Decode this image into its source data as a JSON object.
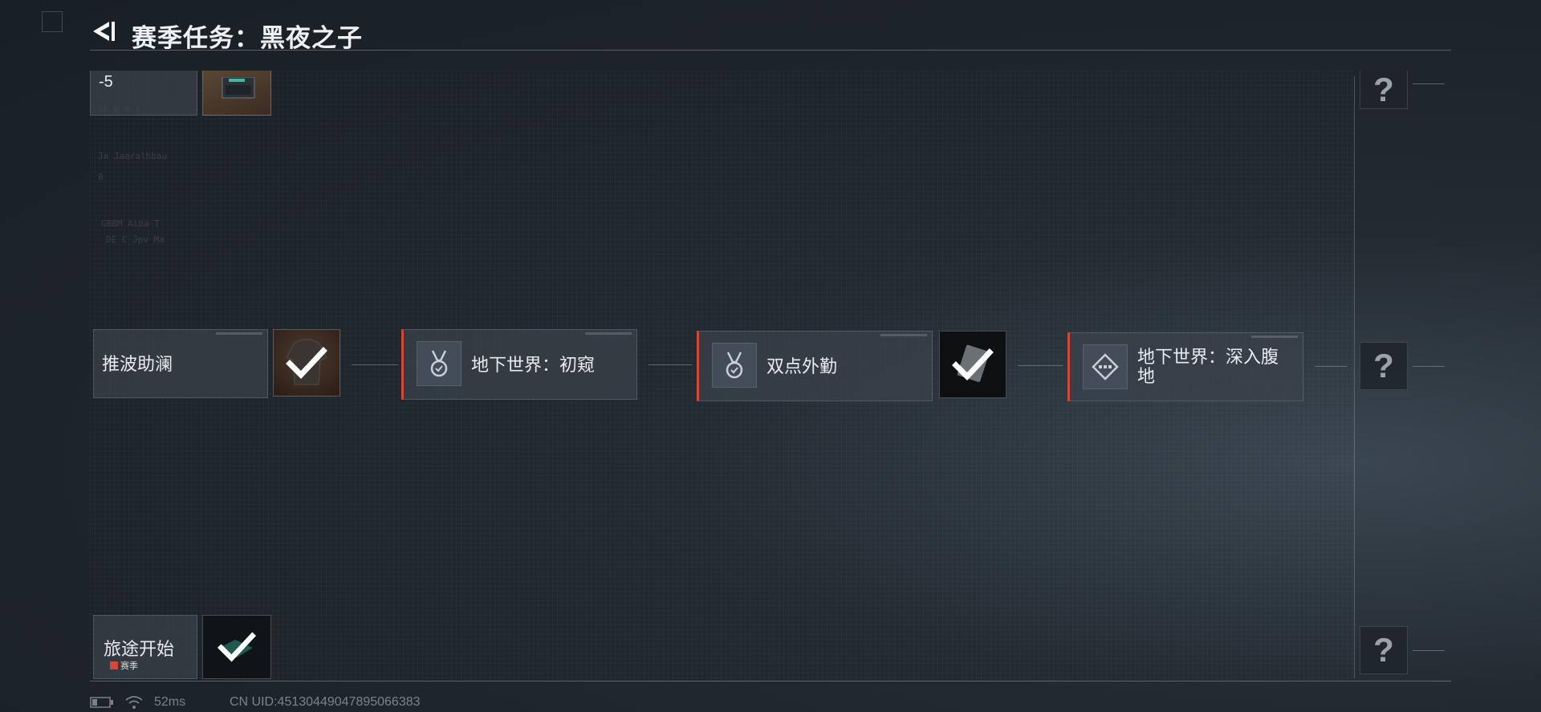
{
  "header": {
    "title": "赛季任务：黑夜之子"
  },
  "partial_top": {
    "label": "-5"
  },
  "missions": [
    {
      "label": "推波助澜"
    },
    {
      "label": "地下世界：初窥"
    },
    {
      "label": "双点外勤"
    },
    {
      "label": "地下世界：深入腹地"
    }
  ],
  "bottom_mission": {
    "label": "旅途开始",
    "badge": "赛季"
  },
  "unknown_rewards": [
    "?",
    "?",
    "?"
  ],
  "status": {
    "ping": "52ms",
    "uid": "CN UID:45130449047895066383"
  },
  "colors": {
    "accent": "#d6473b",
    "check": "#ffffff",
    "background": "#1c2329"
  }
}
